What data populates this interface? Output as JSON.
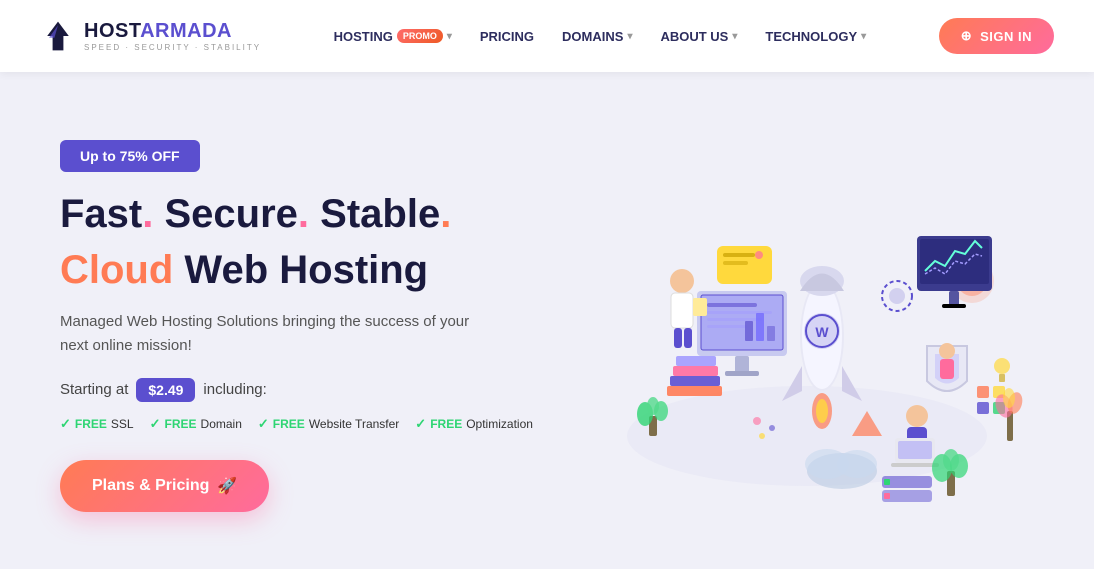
{
  "logo": {
    "host": "HOST",
    "armada": "ARMADA",
    "tagline": "SPEED · SECURITY · STABILITY"
  },
  "nav": {
    "hosting_label": "HOSTING",
    "promo_badge": "PROMO",
    "pricing_label": "PRICING",
    "domains_label": "DOMAINS",
    "about_label": "ABOUT US",
    "technology_label": "TECHNOLOGY",
    "signin_label": "SIGN IN"
  },
  "hero": {
    "discount_badge": "Up to 75% OFF",
    "title_line1": "Fast. Secure. Stable.",
    "title_line2_cloud": "Cloud",
    "title_line2_rest": " Web Hosting",
    "subtitle": "Managed Web Hosting Solutions bringing the success of your next online mission!",
    "starting_text": "Starting at",
    "price": "$2.49",
    "including_text": "including:",
    "free_items": [
      {
        "label": "FREE",
        "text": "SSL"
      },
      {
        "label": "FREE",
        "text": "Domain"
      },
      {
        "label": "FREE",
        "text": "Website Transfer"
      },
      {
        "label": "FREE",
        "text": "Optimization"
      }
    ],
    "cta_label": "Plans & Pricing",
    "cta_icon": "🚀"
  },
  "colors": {
    "purple": "#5b4fcf",
    "pink": "#ff6b9d",
    "orange": "#ff7b54",
    "green": "#2ed573",
    "dark_navy": "#1a1a3e",
    "bg": "#f0f0f8"
  }
}
